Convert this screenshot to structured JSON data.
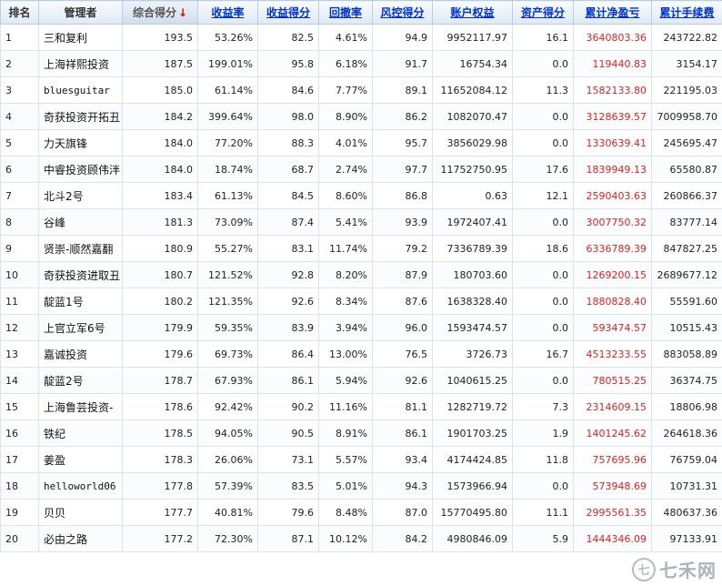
{
  "columns": {
    "rank": "排名",
    "manager": "管理者",
    "score": "综合得分",
    "sort_arrow": "↓",
    "return_rate": "收益率",
    "return_score": "收益得分",
    "drawdown": "回撤率",
    "risk_score": "风控得分",
    "equity": "账户权益",
    "asset_score": "资产得分",
    "net_pnl": "累计净盈亏",
    "fees": "累计手续费"
  },
  "rows": [
    {
      "rank": "1",
      "manager": "三和复利",
      "score": "193.5",
      "return_rate": "53.26%",
      "return_score": "82.5",
      "drawdown": "4.61%",
      "risk_score": "94.9",
      "equity": "9952117.97",
      "asset_score": "16.1",
      "net_pnl": "3640803.36",
      "fees": "243722.82"
    },
    {
      "rank": "2",
      "manager": "上海祥熙投资",
      "score": "187.5",
      "return_rate": "199.01%",
      "return_score": "95.8",
      "drawdown": "6.18%",
      "risk_score": "91.7",
      "equity": "16754.34",
      "asset_score": "0.0",
      "net_pnl": "119440.83",
      "fees": "3154.17"
    },
    {
      "rank": "3",
      "manager": "bluesguitar",
      "score": "185.0",
      "return_rate": "61.14%",
      "return_score": "84.6",
      "drawdown": "7.77%",
      "risk_score": "89.1",
      "equity": "11652084.12",
      "asset_score": "11.3",
      "net_pnl": "1582133.80",
      "fees": "221195.03"
    },
    {
      "rank": "4",
      "manager": "奇获投资开拓丑",
      "score": "184.2",
      "return_rate": "399.64%",
      "return_score": "98.0",
      "drawdown": "8.90%",
      "risk_score": "86.2",
      "equity": "1082070.47",
      "asset_score": "0.0",
      "net_pnl": "3128639.57",
      "fees": "7009958.70"
    },
    {
      "rank": "5",
      "manager": "力天旗锋",
      "score": "184.0",
      "return_rate": "77.20%",
      "return_score": "88.3",
      "drawdown": "4.01%",
      "risk_score": "95.7",
      "equity": "3856029.98",
      "asset_score": "0.0",
      "net_pnl": "1330639.41",
      "fees": "245695.47"
    },
    {
      "rank": "6",
      "manager": "中睿投资顾伟泮",
      "score": "184.0",
      "return_rate": "18.74%",
      "return_score": "68.7",
      "drawdown": "2.74%",
      "risk_score": "97.7",
      "equity": "11752750.95",
      "asset_score": "17.6",
      "net_pnl": "1839949.13",
      "fees": "65580.87"
    },
    {
      "rank": "7",
      "manager": "北斗2号",
      "score": "183.4",
      "return_rate": "61.13%",
      "return_score": "84.5",
      "drawdown": "8.60%",
      "risk_score": "86.8",
      "equity": "0.63",
      "asset_score": "12.1",
      "net_pnl": "2590403.63",
      "fees": "260866.37"
    },
    {
      "rank": "8",
      "manager": "谷峰",
      "score": "181.3",
      "return_rate": "73.09%",
      "return_score": "87.4",
      "drawdown": "5.41%",
      "risk_score": "93.9",
      "equity": "1972407.41",
      "asset_score": "0.0",
      "net_pnl": "3007750.32",
      "fees": "83777.14"
    },
    {
      "rank": "9",
      "manager": "贤崇-顺然嘉翻",
      "score": "180.9",
      "return_rate": "55.27%",
      "return_score": "83.1",
      "drawdown": "11.74%",
      "risk_score": "79.2",
      "equity": "7336789.39",
      "asset_score": "18.6",
      "net_pnl": "6336789.39",
      "fees": "847827.25"
    },
    {
      "rank": "10",
      "manager": "奇获投资进取丑",
      "score": "180.7",
      "return_rate": "121.52%",
      "return_score": "92.8",
      "drawdown": "8.20%",
      "risk_score": "87.9",
      "equity": "180703.60",
      "asset_score": "0.0",
      "net_pnl": "1269200.15",
      "fees": "2689677.12"
    },
    {
      "rank": "11",
      "manager": "靛蓝1号",
      "score": "180.2",
      "return_rate": "121.35%",
      "return_score": "92.6",
      "drawdown": "8.34%",
      "risk_score": "87.6",
      "equity": "1638328.40",
      "asset_score": "0.0",
      "net_pnl": "1880828.40",
      "fees": "55591.60"
    },
    {
      "rank": "12",
      "manager": "上官立军6号",
      "score": "179.9",
      "return_rate": "59.35%",
      "return_score": "83.9",
      "drawdown": "3.94%",
      "risk_score": "96.0",
      "equity": "1593474.57",
      "asset_score": "0.0",
      "net_pnl": "593474.57",
      "fees": "10515.43"
    },
    {
      "rank": "13",
      "manager": "嘉诚投资",
      "score": "179.6",
      "return_rate": "69.73%",
      "return_score": "86.4",
      "drawdown": "13.00%",
      "risk_score": "76.5",
      "equity": "3726.73",
      "asset_score": "16.7",
      "net_pnl": "4513233.55",
      "fees": "883058.89"
    },
    {
      "rank": "14",
      "manager": "靛蓝2号",
      "score": "178.7",
      "return_rate": "67.93%",
      "return_score": "86.1",
      "drawdown": "5.94%",
      "risk_score": "92.6",
      "equity": "1040615.25",
      "asset_score": "0.0",
      "net_pnl": "780515.25",
      "fees": "36374.75"
    },
    {
      "rank": "15",
      "manager": "上海鲁芸投资-",
      "score": "178.6",
      "return_rate": "92.42%",
      "return_score": "90.2",
      "drawdown": "11.16%",
      "risk_score": "81.1",
      "equity": "1282719.72",
      "asset_score": "7.3",
      "net_pnl": "2314609.15",
      "fees": "18806.98"
    },
    {
      "rank": "16",
      "manager": "铁纪",
      "score": "178.5",
      "return_rate": "94.05%",
      "return_score": "90.5",
      "drawdown": "8.91%",
      "risk_score": "86.1",
      "equity": "1901703.25",
      "asset_score": "1.9",
      "net_pnl": "1401245.62",
      "fees": "264618.36"
    },
    {
      "rank": "17",
      "manager": "姜盈",
      "score": "178.3",
      "return_rate": "26.06%",
      "return_score": "73.1",
      "drawdown": "5.57%",
      "risk_score": "93.4",
      "equity": "4174424.85",
      "asset_score": "11.8",
      "net_pnl": "757695.96",
      "fees": "76759.04"
    },
    {
      "rank": "18",
      "manager": "helloworld06",
      "score": "177.8",
      "return_rate": "57.39%",
      "return_score": "83.5",
      "drawdown": "5.01%",
      "risk_score": "94.3",
      "equity": "1573966.94",
      "asset_score": "0.0",
      "net_pnl": "573948.69",
      "fees": "10731.31"
    },
    {
      "rank": "19",
      "manager": "贝贝",
      "score": "177.7",
      "return_rate": "40.81%",
      "return_score": "79.6",
      "drawdown": "8.48%",
      "risk_score": "87.0",
      "equity": "15770495.80",
      "asset_score": "11.1",
      "net_pnl": "2995561.35",
      "fees": "480637.36"
    },
    {
      "rank": "20",
      "manager": "必由之路",
      "score": "177.2",
      "return_rate": "72.30%",
      "return_score": "87.1",
      "drawdown": "10.12%",
      "risk_score": "84.2",
      "equity": "4980846.09",
      "asset_score": "5.9",
      "net_pnl": "1444346.09",
      "fees": "97133.91"
    }
  ],
  "watermark": {
    "logo": "七",
    "text": "七禾网"
  },
  "colors": {
    "header_link": "#0033cc",
    "sort_arrow": "#e00000",
    "net_pnl": "#e02020",
    "border": "#b9cde3"
  }
}
